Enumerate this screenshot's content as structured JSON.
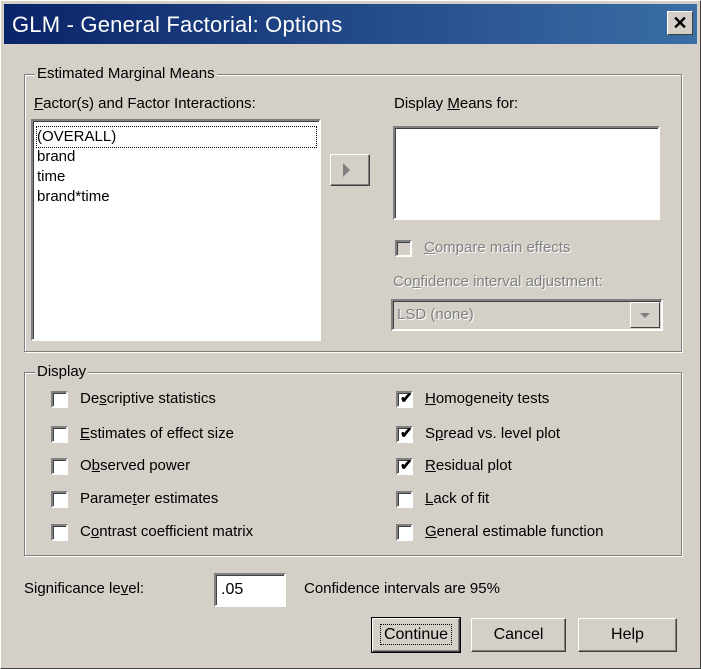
{
  "window": {
    "title": "GLM - General Factorial: Options",
    "close_glyph": "✕"
  },
  "emm": {
    "group_label": "Estimated Marginal Means",
    "factors_label_pre": "",
    "factors_label_u": "F",
    "factors_label_post": "actor(s) and Factor Interactions:",
    "factors": [
      "(OVERALL)",
      "brand",
      "time",
      "brand*time"
    ],
    "display_means_pre": "Display ",
    "display_means_u": "M",
    "display_means_post": "eans for:",
    "compare_pre": "",
    "compare_u": "C",
    "compare_post": "ompare main effects",
    "ci_adj_pre": "Co",
    "ci_adj_u": "n",
    "ci_adj_post": "fidence interval adjustment:",
    "ci_adj_value": "LSD (none)"
  },
  "display": {
    "group_label": "Display",
    "left": [
      {
        "pre": "De",
        "u": "s",
        "post": "criptive statistics",
        "checked": false
      },
      {
        "pre": "",
        "u": "E",
        "post": "stimates of effect size",
        "checked": false
      },
      {
        "pre": "O",
        "u": "b",
        "post": "served power",
        "checked": false
      },
      {
        "pre": "Parame",
        "u": "t",
        "post": "er estimates",
        "checked": false
      },
      {
        "pre": "C",
        "u": "o",
        "post": "ntrast coefficient matrix",
        "checked": false
      }
    ],
    "right": [
      {
        "pre": "",
        "u": "H",
        "post": "omogeneity tests",
        "checked": true
      },
      {
        "pre": "S",
        "u": "p",
        "post": "read vs. level plot",
        "checked": true
      },
      {
        "pre": "",
        "u": "R",
        "post": "esidual plot",
        "checked": true
      },
      {
        "pre": "",
        "u": "L",
        "post": "ack of fit",
        "checked": false
      },
      {
        "pre": "",
        "u": "G",
        "post": "eneral estimable function",
        "checked": false
      }
    ]
  },
  "significance": {
    "pre": "Significance le",
    "u": "v",
    "post": "el:",
    "value": ".05"
  },
  "ci_note": "Confidence intervals are 95%",
  "buttons": {
    "continue": "Continue",
    "cancel": "Cancel",
    "help": "Help"
  },
  "check_glyph": "✔"
}
